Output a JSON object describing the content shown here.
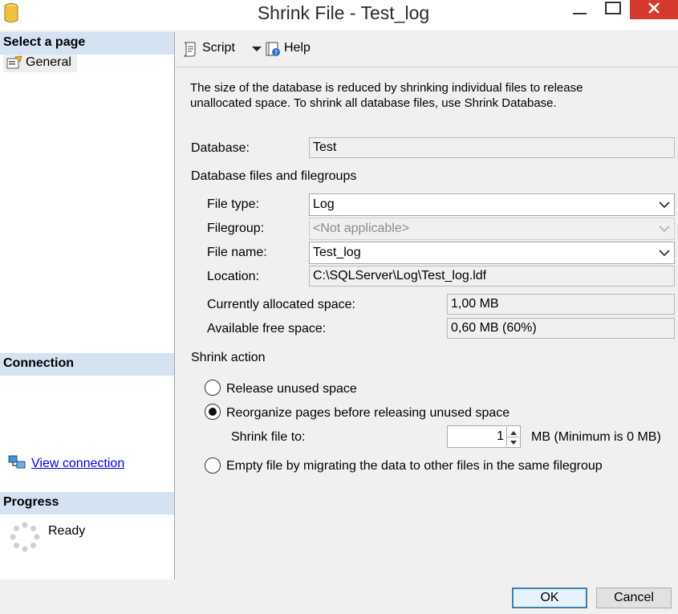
{
  "window": {
    "title": "Shrink File - Test_log",
    "controls": [
      "minimize-icon",
      "maximize-icon",
      "close-icon"
    ],
    "close_color": "#d63a2f"
  },
  "sidebar": {
    "select_page_header": "Select a page",
    "pages": [
      {
        "label": "General",
        "icon": "properties-icon"
      }
    ],
    "connection_header": "Connection",
    "view_connection_label": "View connection",
    "progress_header": "Progress",
    "progress_status": "Ready",
    "header_color": "#d4e2f2"
  },
  "toolbar": {
    "script_label": "Script",
    "help_label": "Help"
  },
  "main": {
    "description": "The size of the database is reduced by shrinking individual files to release unallocated space. To shrink all database files, use Shrink Database.",
    "database_label": "Database:",
    "database_value": "Test",
    "files_group_label": "Database files and filegroups",
    "file_type_label": "File type:",
    "file_type_value": "Log",
    "filegroup_label": "Filegroup:",
    "filegroup_value": "<Not applicable>",
    "file_name_label": "File name:",
    "file_name_value": "Test_log",
    "location_label": "Location:",
    "location_value": "C:\\SQLServer\\Log\\Test_log.ldf",
    "allocated_label": "Currently allocated space:",
    "allocated_value": "1,00 MB",
    "free_label": "Available free space:",
    "free_value": "0,60 MB (60%)",
    "shrink_action_label": "Shrink action",
    "option_release": "Release unused space",
    "option_reorganize": "Reorganize pages before releasing unused space",
    "shrink_to_label": "Shrink file to:",
    "shrink_to_value": "1",
    "shrink_to_unit": "MB (Minimum is 0 MB)",
    "option_empty": "Empty file by migrating the data to other files in the same filegroup",
    "selected_option": "reorganize"
  },
  "buttons": {
    "ok": "OK",
    "cancel": "Cancel"
  }
}
